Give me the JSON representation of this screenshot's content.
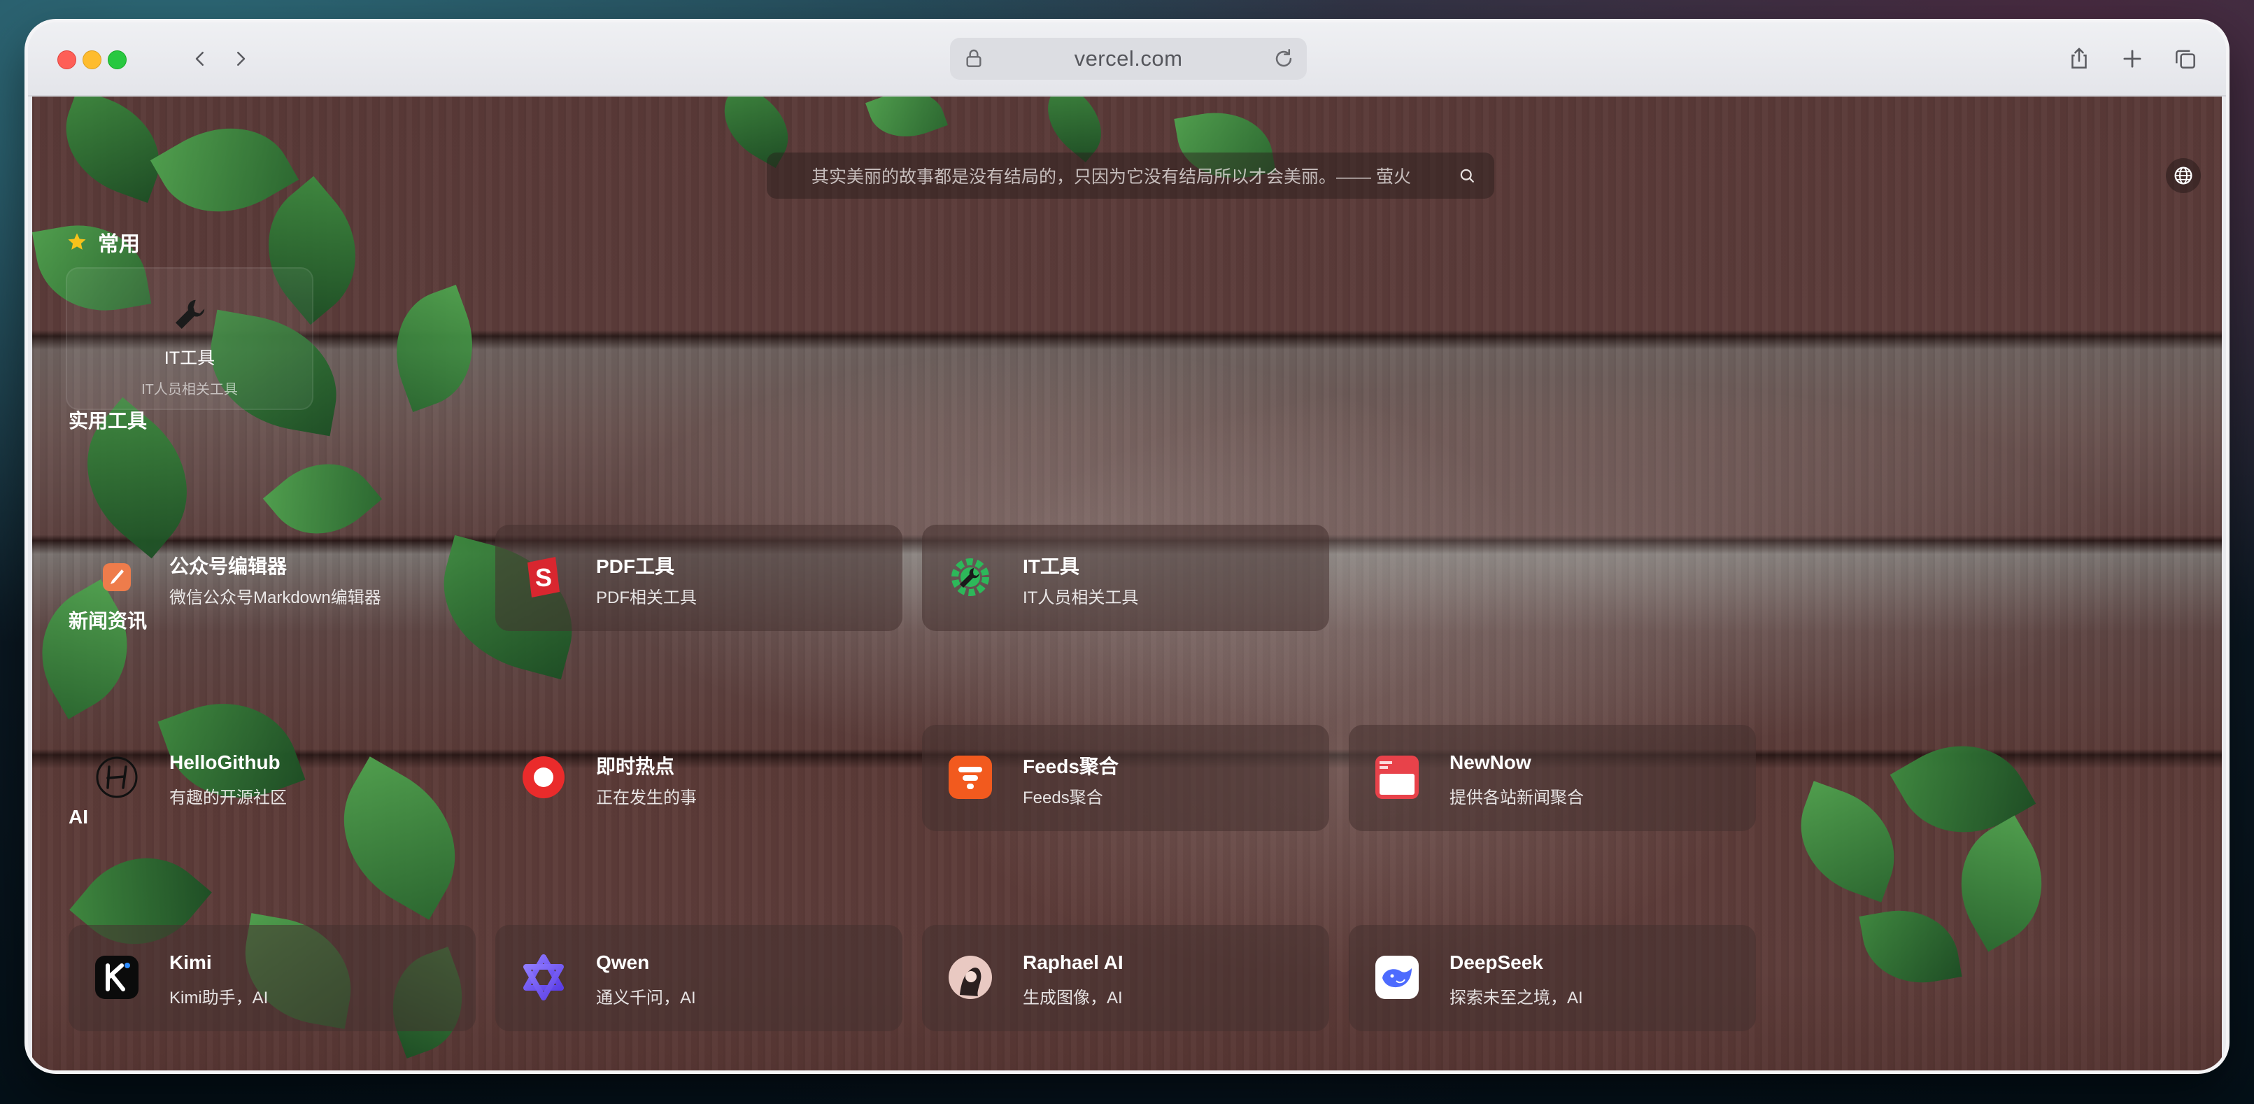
{
  "browser": {
    "url": "vercel.com"
  },
  "search": {
    "placeholder": "其实美丽的故事都是没有结局的，只因为它没有结局所以才会美丽。—— 萤火"
  },
  "favorites": {
    "title": "常用",
    "items": [
      {
        "title": "IT工具",
        "desc": "IT人员相关工具"
      }
    ]
  },
  "sections": [
    {
      "title": "实用工具",
      "cards": [
        {
          "title": "公众号编辑器",
          "desc": "微信公众号Markdown编辑器",
          "icon": "pen-icon"
        },
        {
          "title": "PDF工具",
          "desc": "PDF相关工具",
          "icon": "pdf-s-icon"
        },
        {
          "title": "IT工具",
          "desc": "IT人员相关工具",
          "icon": "wrench-gear-icon"
        }
      ]
    },
    {
      "title": "新闻资讯",
      "cards": [
        {
          "title": "HelloGithub",
          "desc": "有趣的开源社区",
          "icon": "hellogithub-icon"
        },
        {
          "title": "即时热点",
          "desc": "正在发生的事",
          "icon": "hot-dot-icon"
        },
        {
          "title": "Feeds聚合",
          "desc": "Feeds聚合",
          "icon": "feeds-icon"
        },
        {
          "title": "NewNow",
          "desc": "提供各站新闻聚合",
          "icon": "newnow-icon"
        }
      ]
    },
    {
      "title": "AI",
      "cards": [
        {
          "title": "Kimi",
          "desc": "Kimi助手，AI",
          "icon": "kimi-icon"
        },
        {
          "title": "Qwen",
          "desc": "通义千问，AI",
          "icon": "qwen-icon"
        },
        {
          "title": "Raphael AI",
          "desc": "生成图像，AI",
          "icon": "raphael-icon"
        },
        {
          "title": "DeepSeek",
          "desc": "探索未至之境，AI",
          "icon": "deepseek-whale-icon"
        }
      ]
    }
  ],
  "colors": {
    "star": "#f7c21b",
    "feeds": "#f25a1e",
    "hot": "#ea2b2b",
    "newnow": "#e8424a",
    "deepseek": "#4d6bfe"
  }
}
